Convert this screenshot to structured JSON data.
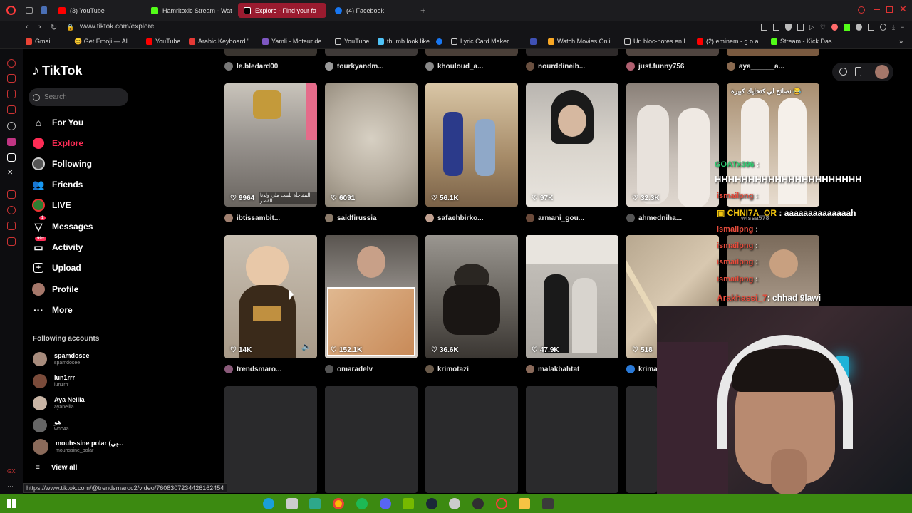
{
  "browser": {
    "tabs": [
      {
        "label": "(3) YouTube",
        "color": "#ff0000"
      },
      {
        "label": "Hamritoxic Stream - Watc",
        "color": "#53fc18"
      },
      {
        "label": "Explore - Find your fa",
        "color": "#ffffff"
      },
      {
        "label": "(4) Facebook",
        "color": "#1877f2"
      }
    ],
    "url": "www.tiktok.com/explore",
    "bookmarks": [
      {
        "label": "Gmail",
        "color": "#ea4335"
      },
      {
        "label": "😊 Get Emoji — Al...",
        "color": "#ffcc33"
      },
      {
        "label": "YouTube",
        "color": "#ff0000"
      },
      {
        "label": "Arabic Keyboard \"...",
        "color": "#e53935"
      },
      {
        "label": "Yamli - Moteur de...",
        "color": "#7e57c2"
      },
      {
        "label": "YouTube",
        "color": "#dddddd"
      },
      {
        "label": "thumb look like",
        "color": "#4fc3f7"
      },
      {
        "label": "Lyric Card Maker",
        "color": "#dddddd"
      },
      {
        "label": "Watch Movies Onli...",
        "color": "#f9a825"
      },
      {
        "label": "Un bloc-notes en l...",
        "color": "#dddddd"
      },
      {
        "label": "(2) eminem - g.o.a...",
        "color": "#ff0000"
      },
      {
        "label": "Stream - Kick Das...",
        "color": "#53fc18"
      }
    ]
  },
  "tiktok": {
    "logo": "TikTok",
    "search_placeholder": "Search",
    "nav": [
      {
        "label": "For You",
        "icon": "home-icon"
      },
      {
        "label": "Explore",
        "icon": "compass-icon"
      },
      {
        "label": "Following",
        "icon": "following-icon"
      },
      {
        "label": "Friends",
        "icon": "friends-icon"
      },
      {
        "label": "LIVE",
        "icon": "live-icon"
      },
      {
        "label": "Messages",
        "icon": "messages-icon",
        "badge": "1"
      },
      {
        "label": "Activity",
        "icon": "activity-icon",
        "badge": "99+"
      },
      {
        "label": "Upload",
        "icon": "upload-icon"
      },
      {
        "label": "Profile",
        "icon": "avatar"
      },
      {
        "label": "More",
        "icon": "more-icon"
      }
    ],
    "following_title": "Following accounts",
    "following": [
      {
        "name": "spamdosee",
        "handle": "spamdosee"
      },
      {
        "name": "lun1rrr",
        "handle": "lun1rrr"
      },
      {
        "name": "Aya Neilla",
        "handle": "ayaneilla"
      },
      {
        "name": "هو",
        "handle": "who4a"
      },
      {
        "name": "mouhssine polar (بي...",
        "handle": "mouhssine_polar"
      }
    ],
    "view_all": "View all",
    "top_row_users": [
      "le.bledard00",
      "tourkyandm...",
      "khouloud_a...",
      "nourddineib...",
      "just.funny756",
      "aya______a..."
    ],
    "row1": [
      {
        "likes": "9964",
        "user": "ibtissambit...",
        "caption": "المفاجأة للبيت ملي ولدنا القصر"
      },
      {
        "likes": "6091",
        "user": "saidfirussia"
      },
      {
        "likes": "56.1K",
        "user": "safaehbirko..."
      },
      {
        "likes": "97K",
        "user": "armani_gou..."
      },
      {
        "likes": "32.3K",
        "user": "ahmedniha..."
      },
      {
        "likes": "",
        "user": "",
        "caption": "نصائح لي كتخليك كبيرة 😂"
      }
    ],
    "row2": [
      {
        "likes": "14K",
        "user": "trendsmaro..."
      },
      {
        "likes": "152.1K",
        "user": "omaradelv"
      },
      {
        "likes": "36.6K",
        "user": "krimotazi"
      },
      {
        "likes": "47.9K",
        "user": "malakbahtat"
      },
      {
        "likes": "518",
        "user": "krima"
      }
    ]
  },
  "chat": [
    {
      "user": "GOATx396",
      "msg": ":",
      "color": "#2ecc71"
    },
    {
      "user": "",
      "msg": "HHHHHHHHHHHHHHHHHHHHHH",
      "color": "#ffffff"
    },
    {
      "user": "ismailpng",
      "msg": ":",
      "color": "#e74c3c"
    },
    {
      "user": "CHNI7A_OR",
      "msg": ": aaaaaaaaaaaaaah",
      "color": "#f1c40f"
    },
    {
      "user": "",
      "msg": "wissa578",
      "color": "#888888"
    },
    {
      "user": "ismailpng",
      "msg": ":",
      "color": "#e74c3c"
    },
    {
      "user": "ismailpng",
      "msg": ":",
      "color": "#e74c3c"
    },
    {
      "user": "ismailpng",
      "msg": ":",
      "color": "#e74c3c"
    },
    {
      "user": "ismailpng",
      "msg": ":",
      "color": "#e74c3c"
    },
    {
      "user": "Arakhassi_7",
      "msg": ": chhad 9lawi",
      "color": "#e74c3c"
    }
  ],
  "status_url": "https://www.tiktok.com/@trendsmaroc2/video/7608307234426162454",
  "colors": {
    "accent": "#fe2c55",
    "taskbar": "#3c8a11"
  }
}
